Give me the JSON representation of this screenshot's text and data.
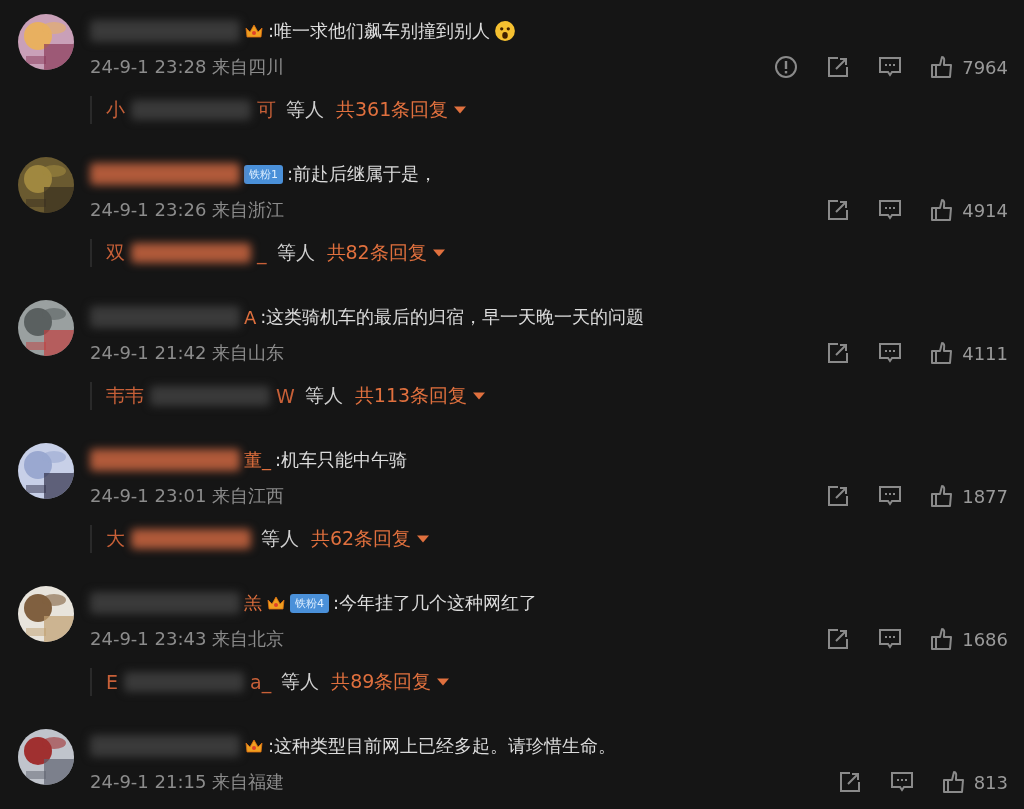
{
  "comments": [
    {
      "avatar": {
        "kind": "picture"
      },
      "badges": [
        {
          "kind": "crown"
        }
      ],
      "text": ":唯一求他们飙车别撞到别人",
      "emoji": true,
      "meta": "24-9-1 23:28 来自四川",
      "report": true,
      "likes": "7964",
      "replies": {
        "first": "小",
        "last": "可",
        "suffix": "等人",
        "count": "共361条回复"
      }
    },
    {
      "avatar": {
        "kind": "picture"
      },
      "badges": [
        {
          "kind": "fan",
          "label": "铁粉1"
        }
      ],
      "text": ":前赴后继属于是，",
      "emoji": false,
      "meta": "24-9-1 23:26 来自浙江",
      "report": false,
      "likes": "4914",
      "replies": {
        "first": "双",
        "last": "_",
        "suffix": "等人",
        "count": "共82条回复"
      }
    },
    {
      "avatar": {
        "kind": "picture"
      },
      "name_end": "A",
      "text": ":这类骑机车的最后的归宿，早一天晚一天的问题",
      "emoji": false,
      "meta": "24-9-1 21:42 来自山东",
      "report": false,
      "likes": "4111",
      "replies": {
        "first": "韦韦",
        "last": "W",
        "suffix": "等人",
        "count": "共113条回复"
      }
    },
    {
      "avatar": {
        "kind": "picture"
      },
      "name_end": "董_",
      "text": ":机车只能中午骑",
      "emoji": false,
      "meta": "24-9-1 23:01 来自江西",
      "report": false,
      "likes": "1877",
      "replies": {
        "first": "大",
        "suffix": "等人",
        "count": "共62条回复"
      }
    },
    {
      "avatar": {
        "kind": "picture"
      },
      "name_end": "羔",
      "badges": [
        {
          "kind": "crown"
        },
        {
          "kind": "fan",
          "label": "铁粉4"
        }
      ],
      "text": ":今年挂了几个这种网红了",
      "emoji": false,
      "meta": "24-9-1 23:43 来自北京",
      "report": false,
      "likes": "1686",
      "replies": {
        "first": "E",
        "last": "a_",
        "suffix": "等人",
        "count": "共89条回复"
      }
    },
    {
      "avatar": {
        "kind": "picture"
      },
      "badges": [
        {
          "kind": "crown"
        }
      ],
      "text": ":这种类型目前网上已经多起。请珍惜生命。",
      "emoji": false,
      "meta": "24-9-1 21:15 来自福建",
      "report": false,
      "likes": "813"
    }
  ]
}
